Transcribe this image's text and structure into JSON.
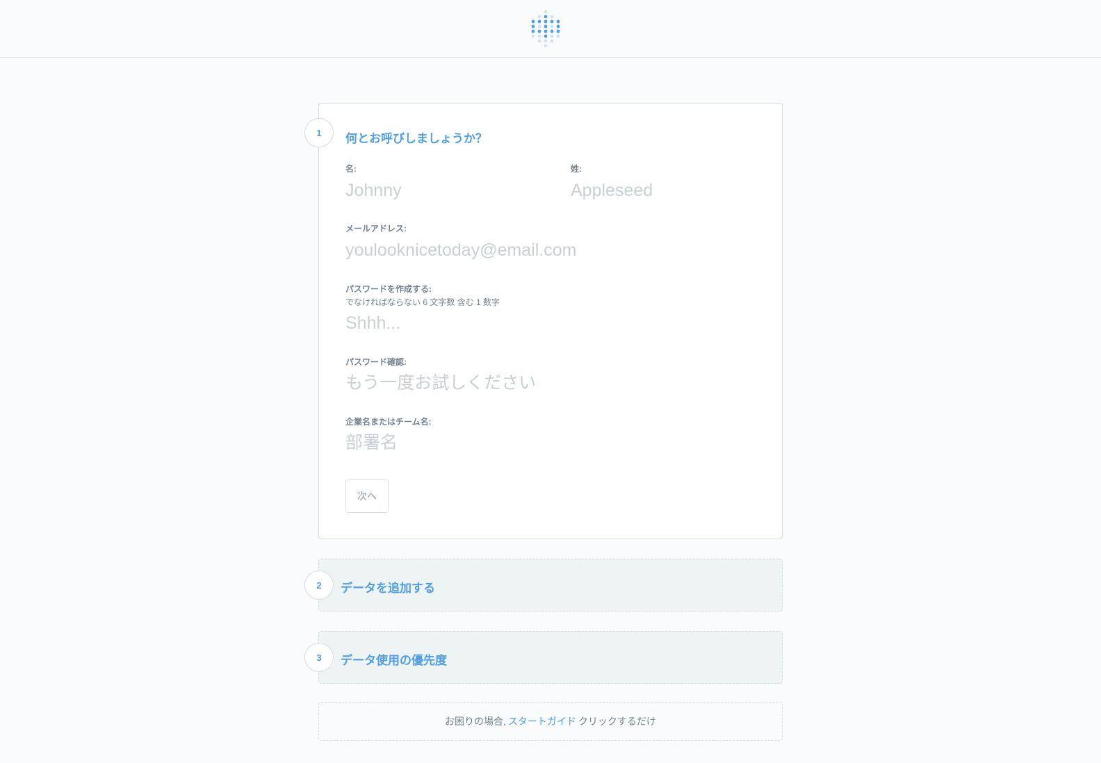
{
  "logo": {
    "icon": "dot-grid-logo-icon",
    "color": "#509ee3"
  },
  "step1": {
    "number": "1",
    "title": "何とお呼びしましょうか？",
    "first_name": {
      "label": "名:",
      "placeholder": "Johnny"
    },
    "last_name": {
      "label": "姓:",
      "placeholder": "Appleseed"
    },
    "email": {
      "label": "メールアドレス:",
      "placeholder": "youlooknicetoday@email.com"
    },
    "password": {
      "label": "パスワードを作成する:",
      "hint": "でなければならない 6 文字数 含む 1 数字",
      "placeholder": "Shhh..."
    },
    "password_confirm": {
      "label": "パスワード確認:",
      "placeholder": "もう一度お試しください"
    },
    "company": {
      "label": "企業名またはチーム名:",
      "placeholder": "部署名"
    },
    "next_label": "次へ"
  },
  "step2": {
    "number": "2",
    "title": "データを追加する"
  },
  "step3": {
    "number": "3",
    "title": "データ使用の優先度"
  },
  "help": {
    "prefix": "お困りの場合,",
    "link": "スタートガイド",
    "suffix": "クリックするだけ"
  },
  "colors": {
    "accent": "#509ee3",
    "muted": "#74838f",
    "placeholder": "#c8d0d4",
    "collapsed_bg": "#eef3f4"
  }
}
